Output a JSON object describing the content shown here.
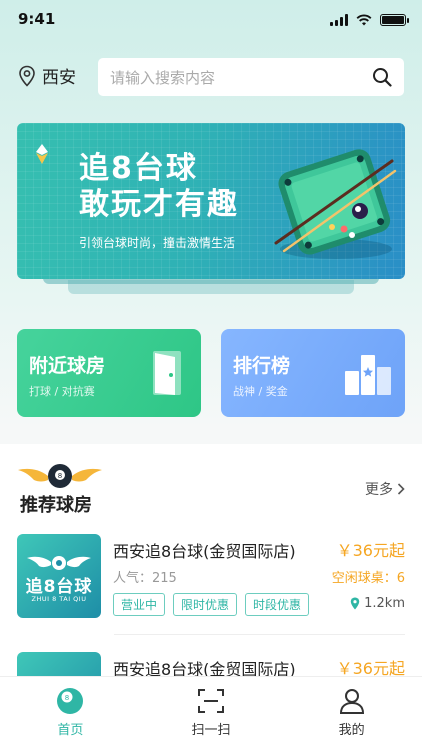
{
  "status_bar": {
    "time": "9:41"
  },
  "location": {
    "city": "西安"
  },
  "search": {
    "placeholder": "请输入搜索内容"
  },
  "banner": {
    "title_line1": "追8台球",
    "title_line2": "敢玩才有趣",
    "subtitle": "引领台球时尚，撞击激情生活"
  },
  "cards": [
    {
      "title": "附近球房",
      "subtitle": "打球 / 对抗赛",
      "icon": "door-icon",
      "color": "#35c98c"
    },
    {
      "title": "排行榜",
      "subtitle": "战神 / 奖金",
      "icon": "podium-icon",
      "color": "#79adfc"
    }
  ],
  "recommend": {
    "title": "推荐球房",
    "more_label": "更多",
    "stores": [
      {
        "thumb_line1": "追8台球",
        "thumb_line2": "ZHUI 8 TAI QIU",
        "name": "西安追8台球(金贸国际店)",
        "price": "￥36元起",
        "popularity": "人气：215",
        "idle": "空闲球桌：6",
        "tags": [
          "营业中",
          "限时优惠",
          "时段优惠"
        ],
        "distance": "1.2km"
      },
      {
        "name": "西安追8台球(金贸国际店)",
        "price": "￥36元起"
      }
    ]
  },
  "tabbar": {
    "tabs": [
      {
        "label": "首页",
        "icon": "billiard-ball-icon",
        "active": true
      },
      {
        "label": "扫一扫",
        "icon": "scan-icon",
        "active": false
      },
      {
        "label": "我的",
        "icon": "user-icon",
        "active": false
      }
    ]
  },
  "colors": {
    "accent": "#2fb6a5",
    "price": "#f5a623",
    "green_card": "#35c98c",
    "blue_card": "#79adfc"
  }
}
